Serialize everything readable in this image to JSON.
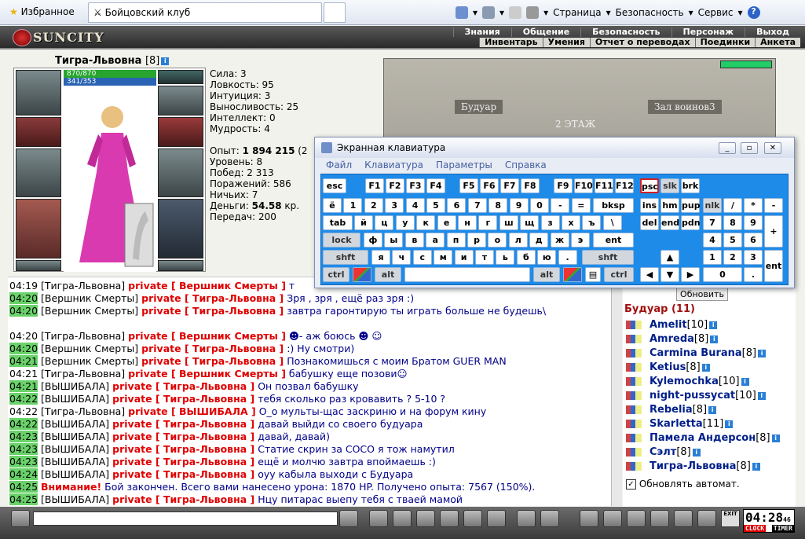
{
  "browser": {
    "tab_favorites": "Избранное",
    "tab_active": "Бойцовский клуб",
    "menu_page": "Страница",
    "menu_security": "Безопасность",
    "menu_service": "Сервис"
  },
  "game": {
    "logo": "SUNCITY",
    "nav_top": [
      "Знания",
      "Общение",
      "Безопасность",
      "Персонаж",
      "Выход"
    ],
    "nav_sub": [
      "Инвентарь",
      "Умения",
      "Отчет о переводах",
      "Поединки",
      "Анкета"
    ],
    "player": {
      "name": "Тигра-Львовна",
      "level": "[8]",
      "hp": "870/870",
      "mana": "341/353"
    },
    "stats": [
      "Сила: 3",
      "Ловкость: 95",
      "Интуиция: 3",
      "Выносливость: 25",
      "Интеллект: 0",
      "Мудрость: 4"
    ],
    "stats2": [
      {
        "label": "Опыт: ",
        "value": "1 894 215",
        "suffix": " (2"
      },
      {
        "label": "Уровень: 8",
        "value": "",
        "suffix": ""
      },
      {
        "label": "Побед: 2 313",
        "value": "",
        "suffix": ""
      },
      {
        "label": "Поражений: 586",
        "value": "",
        "suffix": ""
      },
      {
        "label": "Ничьих: 7",
        "value": "",
        "suffix": ""
      },
      {
        "label": "Деньги: ",
        "value": "54.58",
        "suffix": " кр."
      },
      {
        "label": "Передач: 200",
        "value": "",
        "suffix": ""
      }
    ],
    "map": {
      "left": "Будуар",
      "right": "Зал воинов3",
      "floor": "2 ЭТАЖ"
    }
  },
  "chat": [
    {
      "t": "04:19",
      "g": false,
      "from": "[Тигра-Львовна]",
      "to": "private [ Вершник Смерты ]",
      "msg": "т"
    },
    {
      "t": "04:20",
      "g": true,
      "from": "[Вершник Смерты]",
      "to": "private [ Тигра-Львовна ]",
      "msg": "Зря , зря , ещё раз зря :)"
    },
    {
      "t": "04:20",
      "g": true,
      "from": "[Вершник Смерты]",
      "to": "private [ Тигра-Львовна ]",
      "msg": "завтра гаронтирую ты играть больше не будешь\\"
    },
    {
      "t": "",
      "g": false,
      "from": "",
      "to": "",
      "msg": ""
    },
    {
      "t": "04:20",
      "g": false,
      "from": "[Тигра-Львовна]",
      "to": "private [ Вершник Смерты ]",
      "msg": "☻- аж боюсь ☻  ☺"
    },
    {
      "t": "04:20",
      "g": true,
      "from": "[Вершник Смерты]",
      "to": "private [ Тигра-Львовна ]",
      "msg": ":) Ну смотри)"
    },
    {
      "t": "04:21",
      "g": true,
      "from": "[Вершник Смерты]",
      "to": "private [ Тигра-Львовна ]",
      "msg": "Познакомишься с моим Братом GUER MAN"
    },
    {
      "t": "04:21",
      "g": false,
      "from": "[Тигра-Львовна]",
      "to": "private [ Вершник Смерты ]",
      "msg": "бабушку еще позови☺"
    },
    {
      "t": "04:21",
      "g": true,
      "from": "[ВЫШИБАЛА]",
      "to": "private [ Тигра-Львовна ]",
      "msg": "Он позвал бабушку"
    },
    {
      "t": "04:22",
      "g": true,
      "from": "[ВЫШИБАЛА]",
      "to": "private [ Тигра-Львовна ]",
      "msg": "тебя сколько раз кровавить ? 5-10 ?"
    },
    {
      "t": "04:22",
      "g": false,
      "from": "[Тигра-Львовна]",
      "to": "private [ ВЫШИБАЛА ]",
      "msg": "О_о мульты-щас заскриню и на форум кину"
    },
    {
      "t": "04:22",
      "g": true,
      "from": "[ВЫШИБАЛА]",
      "to": "private [ Тигра-Львовна ]",
      "msg": "давай выйди со своего будуара"
    },
    {
      "t": "04:23",
      "g": true,
      "from": "[ВЫШИБАЛА]",
      "to": "private [ Тигра-Львовна ]",
      "msg": "давай, давай)"
    },
    {
      "t": "04:23",
      "g": true,
      "from": "[ВЫШИБАЛА]",
      "to": "private [ Тигра-Львовна ]",
      "msg": "Статие скрин за СОСО я тож намутил"
    },
    {
      "t": "04:23",
      "g": true,
      "from": "[ВЫШИБАЛА]",
      "to": "private [ Тигра-Львовна ]",
      "msg": "ещё и молчю завтра впоймаешь :)"
    },
    {
      "t": "04:24",
      "g": true,
      "from": "[ВЫШИБАЛА]",
      "to": "private [ Тигра-Львовна ]",
      "msg": "оуу кабыла выходи с Будуара"
    },
    {
      "t": "04:25",
      "g": true,
      "from": "",
      "to": "Внимание!",
      "msg": " Бой закончен. Всего вами нанесено урона: 1870 HP. Получено опыта: 7567 (150%)."
    },
    {
      "t": "04:25",
      "g": true,
      "from": "[ВЫШИБАЛА]",
      "to": "private [ Тигра-Львовна ]",
      "msg": "Нцу питарас выепу тебя с тваей мамой"
    }
  ],
  "room": {
    "refresh": "Обновить",
    "title": "Будуар (11)",
    "auto": "Обновлять автомат.",
    "users": [
      {
        "n": "Amelit",
        "l": "[10]"
      },
      {
        "n": "Amreda",
        "l": "[8]"
      },
      {
        "n": "Carmina Burana",
        "l": "[8]"
      },
      {
        "n": "Ketius",
        "l": "[8]"
      },
      {
        "n": "Kylemochka",
        "l": "[10]"
      },
      {
        "n": "night-pussycat",
        "l": "[10]"
      },
      {
        "n": "Rebelia",
        "l": "[8]"
      },
      {
        "n": "Skarletta",
        "l": "[11]"
      },
      {
        "n": "Памела Андерсон",
        "l": "[8]"
      },
      {
        "n": "Сэлт",
        "l": "[8]"
      },
      {
        "n": "Тигра-Львовна",
        "l": "[8]"
      }
    ]
  },
  "clock": {
    "time": "04:28",
    "sec": "46",
    "clock": "CLOCK",
    "timer": "TIMER",
    "exit": "EXIT"
  },
  "osk": {
    "title": "Экранная клавиатура",
    "menu": [
      "Файл",
      "Клавиатура",
      "Параметры",
      "Справка"
    ]
  }
}
